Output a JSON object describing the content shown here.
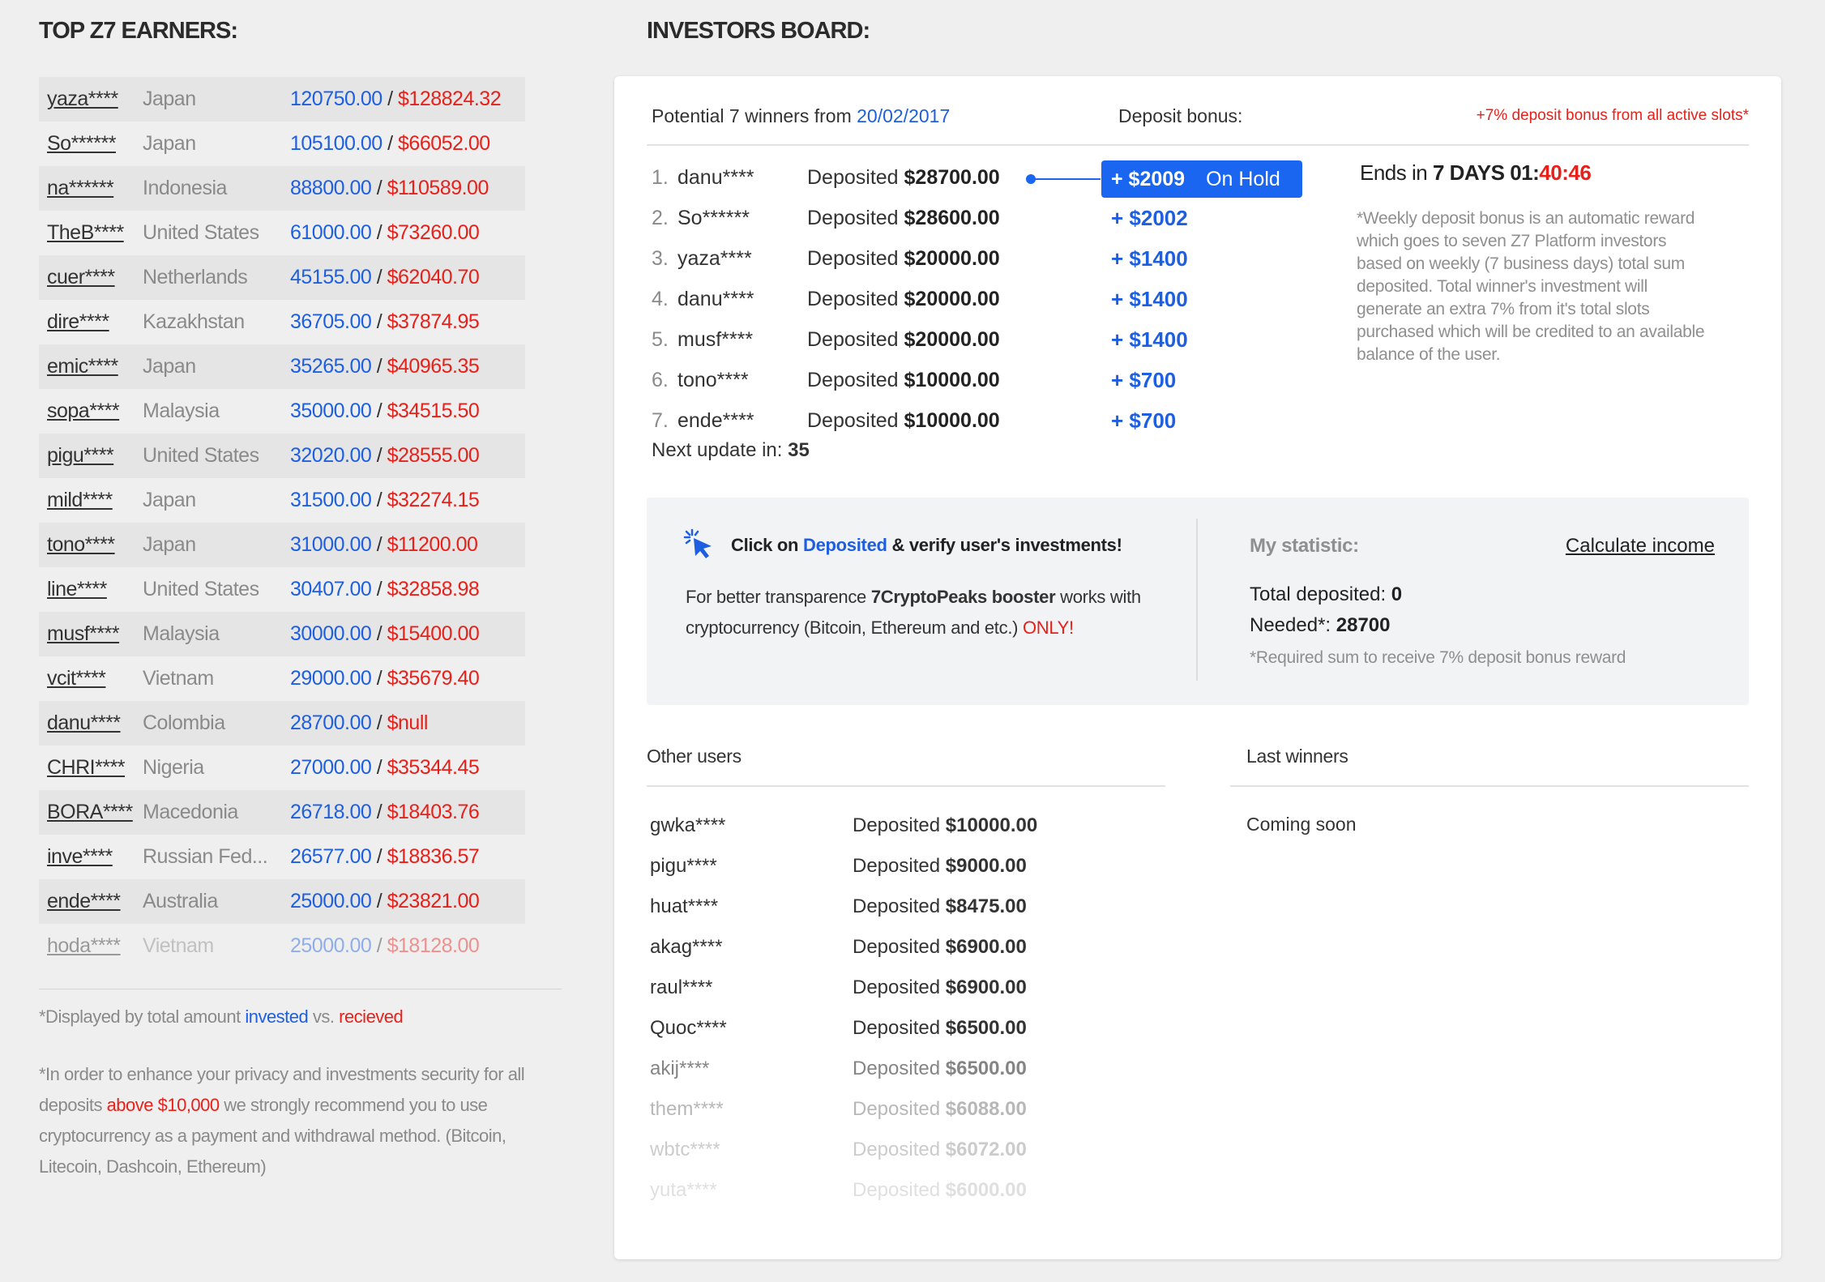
{
  "left": {
    "title": "TOP Z7 EARNERS:",
    "earners": [
      {
        "name": "yaza****",
        "country": "Japan",
        "invested": "120750.00",
        "received": "$128824.32"
      },
      {
        "name": "So******",
        "country": "Japan",
        "invested": "105100.00",
        "received": "$66052.00"
      },
      {
        "name": "na******",
        "country": "Indonesia",
        "invested": "88800.00",
        "received": "$110589.00"
      },
      {
        "name": "TheB****",
        "country": "United States",
        "invested": "61000.00",
        "received": "$73260.00"
      },
      {
        "name": "cuer****",
        "country": "Netherlands",
        "invested": "45155.00",
        "received": "$62040.70"
      },
      {
        "name": "dire****",
        "country": "Kazakhstan",
        "invested": "36705.00",
        "received": "$37874.95"
      },
      {
        "name": "emic****",
        "country": "Japan",
        "invested": "35265.00",
        "received": "$40965.35"
      },
      {
        "name": "sopa****",
        "country": "Malaysia",
        "invested": "35000.00",
        "received": "$34515.50"
      },
      {
        "name": "pigu****",
        "country": "United States",
        "invested": "32020.00",
        "received": "$28555.00"
      },
      {
        "name": "mild****",
        "country": "Japan",
        "invested": "31500.00",
        "received": "$32274.15"
      },
      {
        "name": "tono****",
        "country": "Japan",
        "invested": "31000.00",
        "received": "$11200.00"
      },
      {
        "name": "line****",
        "country": "United States",
        "invested": "30407.00",
        "received": "$32858.98"
      },
      {
        "name": "musf****",
        "country": "Malaysia",
        "invested": "30000.00",
        "received": "$15400.00"
      },
      {
        "name": "vcit****",
        "country": "Vietnam",
        "invested": "29000.00",
        "received": "$35679.40"
      },
      {
        "name": "danu****",
        "country": "Colombia",
        "invested": "28700.00",
        "received": "$null"
      },
      {
        "name": "CHRI****",
        "country": "Nigeria",
        "invested": "27000.00",
        "received": "$35344.45"
      },
      {
        "name": "BORA****",
        "country": "Macedonia",
        "invested": "26718.00",
        "received": "$18403.76"
      },
      {
        "name": "inve****",
        "country": "Russian Fed...",
        "invested": "26577.00",
        "received": "$18836.57"
      },
      {
        "name": "ende****",
        "country": "Australia",
        "invested": "25000.00",
        "received": "$23821.00"
      },
      {
        "name": "hoda****",
        "country": "Vietnam",
        "invested": "25000.00",
        "received": "$18128.00"
      }
    ],
    "separator": " / ",
    "note1_prefix": "*Displayed by total amount ",
    "note1_invested": "invested",
    "note1_vs": " vs. ",
    "note1_received": "recieved",
    "note2_prefix": "*In order to enhance your privacy and investments security for all deposits ",
    "note2_highlight": "above $10,000",
    "note2_suffix": " we strongly recommend you to use cryptocurrency as a payment and withdrawal method. (Bitcoin, Litecoin, Dashcoin, Ethereum)"
  },
  "board": {
    "title": "INVESTORS BOARD:",
    "potential_prefix": "Potential 7 winners from ",
    "potential_date": "20/02/2017",
    "deposit_bonus_label": "Deposit bonus:",
    "bonus_note": "+7% deposit bonus from all active slots*",
    "winners": [
      {
        "num": "1.",
        "name": "danu****",
        "dep_label": "Deposited ",
        "amount": "$28700.00",
        "bonus": "+ $2009"
      },
      {
        "num": "2.",
        "name": "So******",
        "dep_label": "Deposited ",
        "amount": "$28600.00",
        "bonus": "+ $2002"
      },
      {
        "num": "3.",
        "name": "yaza****",
        "dep_label": "Deposited ",
        "amount": "$20000.00",
        "bonus": "+ $1400"
      },
      {
        "num": "4.",
        "name": "danu****",
        "dep_label": "Deposited ",
        "amount": "$20000.00",
        "bonus": "+ $1400"
      },
      {
        "num": "5.",
        "name": "musf****",
        "dep_label": "Deposited ",
        "amount": "$20000.00",
        "bonus": "+ $1400"
      },
      {
        "num": "6.",
        "name": "tono****",
        "dep_label": "Deposited ",
        "amount": "$10000.00",
        "bonus": "+ $700"
      },
      {
        "num": "7.",
        "name": "ende****",
        "dep_label": "Deposited ",
        "amount": "$10000.00",
        "bonus": "+ $700"
      }
    ],
    "on_hold_label": "On Hold",
    "next_update_label": "Next update in: ",
    "next_update_value": "35",
    "ends_prefix": "Ends in ",
    "ends_days": "7 DAYS 01:",
    "ends_timer": "40:46",
    "weekly_note": "*Weekly deposit bonus is an automatic reward which goes to seven Z7 Platform investors based on weekly (7 business days) total sum deposited. Total winner's investment will generate an extra 7% from it's total slots purchased which will be credited to an available balance of the user.",
    "info": {
      "click_prefix": "Click on ",
      "click_link": "Deposited",
      "click_suffix": " & verify user's investments!",
      "trans_prefix": "For better transparence ",
      "trans_bold": "7CryptoPeaks booster",
      "trans_mid": " works with cryptocurrency (Bitcoin, Ethereum and etc.) ",
      "trans_only": "ONLY!",
      "my_statistic": "My statistic:",
      "calculate_income": "Calculate income",
      "total_deposited_label": "Total deposited: ",
      "total_deposited_value": "0",
      "needed_label": "Needed*: ",
      "needed_value": "28700",
      "required_note": "*Required sum to receive 7% deposit bonus reward"
    },
    "other_users_title": "Other users",
    "last_winners_title": "Last winners",
    "coming_soon": "Coming soon",
    "other_users": [
      {
        "name": "gwka****",
        "dep_label": "Deposited ",
        "amount": "$10000.00"
      },
      {
        "name": "pigu****",
        "dep_label": "Deposited ",
        "amount": "$9000.00"
      },
      {
        "name": "huat****",
        "dep_label": "Deposited ",
        "amount": "$8475.00"
      },
      {
        "name": "akag****",
        "dep_label": "Deposited ",
        "amount": "$6900.00"
      },
      {
        "name": "raul****",
        "dep_label": "Deposited ",
        "amount": "$6900.00"
      },
      {
        "name": "Quoc****",
        "dep_label": "Deposited ",
        "amount": "$6500.00"
      },
      {
        "name": "akij****",
        "dep_label": "Deposited ",
        "amount": "$6500.00"
      },
      {
        "name": "them****",
        "dep_label": "Deposited ",
        "amount": "$6088.00"
      },
      {
        "name": "wbtc****",
        "dep_label": "Deposited ",
        "amount": "$6072.00"
      },
      {
        "name": "yuta****",
        "dep_label": "Deposited ",
        "amount": "$6000.00"
      }
    ]
  },
  "colors": {
    "blue": "#1d5fe0",
    "red": "#e8201a",
    "on_hold_bg": "#1a66f0"
  },
  "icons": {
    "click": "cursor-click-icon"
  }
}
